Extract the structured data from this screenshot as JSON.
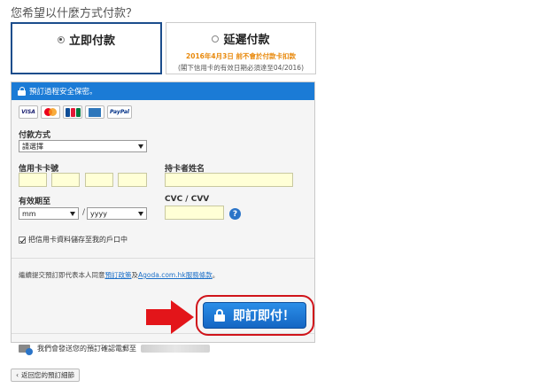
{
  "question": "您希望以什麼方式付款？",
  "payment_options": {
    "pay_now": {
      "label": "立即付款",
      "selected": true
    },
    "pay_later": {
      "label": "延遲付款",
      "selected": false,
      "note": "2016年4月3日 前不會於付款卡扣款",
      "sub_note": "(閣下信用卡的有效日期必須達至04/2016)"
    }
  },
  "secure_banner": "預訂過程安全保密。",
  "cards": [
    "VISA",
    "MasterCard",
    "JCB",
    "AMEX",
    "PayPal"
  ],
  "form": {
    "method_label": "付款方式",
    "method_value": "請選擇",
    "card_number_label": "信用卡卡號",
    "holder_label": "持卡者姓名",
    "expiry_label": "有效期至",
    "month_value": "mm",
    "year_value": "yyyy",
    "slash": "/",
    "cvc_label": "CVC / CVV",
    "help": "?",
    "save_card_label": "把信用卡資料儲存至我的戶口中"
  },
  "terms": {
    "prefix": "繼續提交預訂即代表本人同意",
    "policy_link": "預訂政策",
    "and": "及",
    "site_link": "Agoda.com.hk服務條款",
    "suffix": "。"
  },
  "book_button": "即訂即付！",
  "email_note": "我們會發送您的預訂確認電郵至",
  "back_button": "返回您的預訂細節",
  "colors": {
    "brand_blue": "#1b7bd6",
    "highlight_red": "#e3151a",
    "field_yellow": "#ffffd6",
    "later_orange": "#e8890c"
  }
}
